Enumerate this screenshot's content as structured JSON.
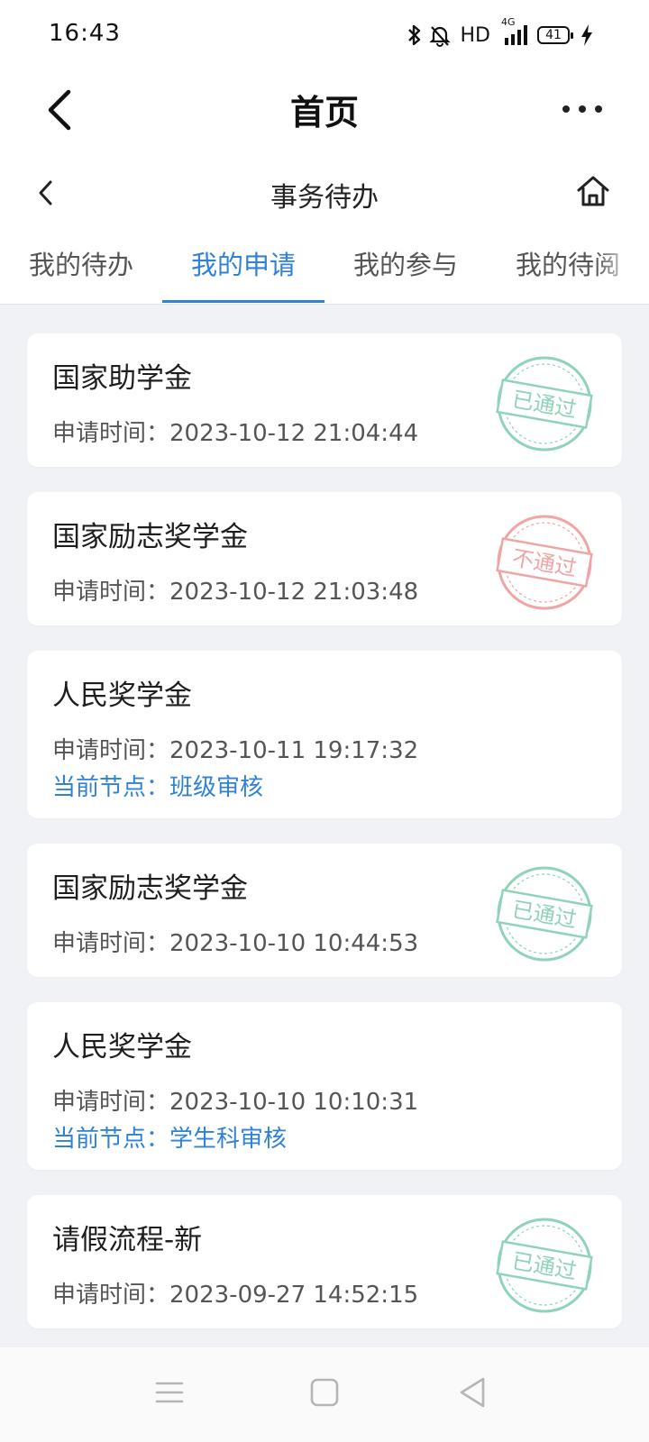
{
  "status_bar": {
    "time": "16:43",
    "hd": "HD",
    "network": "4G",
    "battery": "41",
    "icons": [
      "bluetooth-icon",
      "bell-off-icon",
      "signal-icon",
      "battery-icon",
      "charging-icon"
    ]
  },
  "app_bar": {
    "title": "首页",
    "icons": [
      "back-arrow-icon",
      "more-icon"
    ]
  },
  "sub_bar": {
    "title": "事务待办",
    "icons": [
      "back-chevron-icon",
      "home-icon"
    ]
  },
  "tabs": [
    {
      "label": "我的待办",
      "active": false
    },
    {
      "label": "我的申请",
      "active": true
    },
    {
      "label": "我的参与",
      "active": false
    },
    {
      "label": "我的待阅",
      "active": false
    }
  ],
  "accent_color": "#2f82d8",
  "stamp_colors": {
    "approved": "#8fd3b8",
    "rejected": "#f0a5a5"
  },
  "applications": [
    {
      "title": "国家助学金",
      "time_label": "申请时间：",
      "time": "2023-10-12 21:04:44",
      "stamp": "已通过",
      "stamp_type": "approved"
    },
    {
      "title": "国家励志奖学金",
      "time_label": "申请时间：",
      "time": "2023-10-12 21:03:48",
      "stamp": "不通过",
      "stamp_type": "rejected"
    },
    {
      "title": "人民奖学金",
      "time_label": "申请时间：",
      "time": "2023-10-11 19:17:32",
      "node_label": "当前节点：",
      "node": "班级审核"
    },
    {
      "title": "国家励志奖学金",
      "time_label": "申请时间：",
      "time": "2023-10-10 10:44:53",
      "stamp": "已通过",
      "stamp_type": "approved"
    },
    {
      "title": "人民奖学金",
      "time_label": "申请时间：",
      "time": "2023-10-10 10:10:31",
      "node_label": "当前节点：",
      "node": "学生科审核"
    },
    {
      "title": "请假流程-新",
      "time_label": "申请时间：",
      "time": "2023-09-27 14:52:15",
      "stamp": "已通过",
      "stamp_type": "approved"
    }
  ],
  "nav_bar": {
    "icons": [
      "menu-icon",
      "home-square-icon",
      "back-triangle-icon"
    ]
  }
}
